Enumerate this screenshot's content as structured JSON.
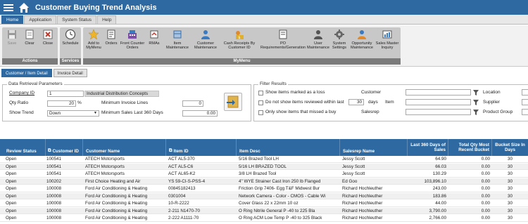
{
  "app": {
    "title": "Customer Buying Trend Analysis"
  },
  "tabs": [
    {
      "label": "Home",
      "active": true
    },
    {
      "label": "Application",
      "active": false
    },
    {
      "label": "System Status",
      "active": false
    },
    {
      "label": "Help",
      "active": false
    }
  ],
  "ribbon": {
    "actions": {
      "label": "Actions",
      "buttons": [
        "Save",
        "Clear",
        "Close"
      ]
    },
    "services": {
      "label": "Services",
      "buttons": [
        "Schedule"
      ]
    },
    "mymenu": {
      "label": "MyMenu",
      "buttons": [
        "Add to\nMyMenu",
        "Orders",
        "Front Counter\nOrders",
        "RMAs",
        "Item\nMaintenance",
        "Customer\nMaintenance",
        "Cash Receipts By\nCustomer ID",
        "PO\nRequirements/Generation",
        "User\nMaintenance",
        "System\nSettings",
        "Opportunity\nMaintenance",
        "Sales Master\nInquiry"
      ]
    }
  },
  "subtabs": [
    {
      "label": "Customer / Item Detail",
      "active": true
    },
    {
      "label": "Invoice Detail",
      "active": false
    }
  ],
  "params": {
    "legend": "Data Retrieval Parameters",
    "company_id_label": "Company ID",
    "company_id": "1",
    "company_name": "Industrial Distribution Concepts",
    "qty_ratio_label": "Qty Ratio",
    "qty_ratio": "20",
    "qty_ratio_unit": "%",
    "min_invoice_lines_label": "Minimum Invoice Lines",
    "min_invoice_lines": "0",
    "show_trend_label": "Show Trend",
    "show_trend": "Down",
    "min_sales_label": "Minimum Sales Last 360 Days",
    "min_sales": "0.00"
  },
  "filters": {
    "legend": "Filter Results",
    "loss_label": "Show items marked as a loss",
    "not_reviewed_label": "Do not show items reviewed within last",
    "not_reviewed_days": "30",
    "days_label": "days",
    "missed_buy_label": "Only show items that missed a buy",
    "customer_label": "Customer",
    "item_label": "Item",
    "salesrep_label": "Salesrep",
    "location_label": "Location",
    "supplier_label": "Supplier",
    "product_group_label": "Product Group"
  },
  "grid": {
    "columns": [
      "Review Status",
      "Customer ID",
      "Customer Name",
      "Item ID",
      "Item Desc",
      "Salesrep Name",
      "Last 360 Days of Sales",
      "Total Qty Most Recent Bucket",
      "Bucket Size In Days"
    ],
    "rows": [
      [
        "Open",
        "100541",
        "ATECH Motorsports",
        "ACT AL5-370",
        "5/16 Brazed Tool LH",
        "Jessy Scott",
        "64.90",
        "0.00",
        "30"
      ],
      [
        "Open",
        "100541",
        "ATECH Motorsports",
        "ACT AL5-C6",
        "5/16 LH BRAZED TOOL",
        "Jessy Scott",
        "66.03",
        "0.00",
        "30"
      ],
      [
        "Open",
        "100541",
        "ATECH Motorsports",
        "ACT AL65-K2",
        "3/8 LH Brazed Tool",
        "Jessy Scott",
        "130.29",
        "0.00",
        "30"
      ],
      [
        "Open",
        "100202",
        "First Choice Heating and Air",
        "YS 59-CI-S-PSS-4",
        "4\" WYE Strainer Cast Iron 250 lb Flanged",
        "Ed Goo",
        "103,896.10",
        "0.00",
        "30"
      ],
      [
        "Open",
        "100008",
        "Ford Air Conditioning & Heating",
        "00845182413",
        "Friction Grip 7406- Egg T&F Midwest Bur",
        "Richard Hochleuther",
        "243.00",
        "0.00",
        "30"
      ],
      [
        "Open",
        "100008",
        "Ford Air Conditioning & Heating",
        "0301004",
        "Network Camera - Color - CMOS - Cable Wi",
        "Richard Hochleuther",
        "183.86",
        "0.00",
        "30"
      ],
      [
        "Open",
        "100008",
        "Ford Air Conditioning & Heating",
        "10-R-2222",
        "Cover Glass 22 x 22mm 10 oz",
        "Richard Hochleuther",
        "44.00",
        "0.00",
        "30"
      ],
      [
        "Open",
        "100008",
        "Ford Air Conditioning & Heating",
        "2-211 N1470-70",
        "O Ring Nitrile General P -40 to 225 Bla",
        "Richard Hochleuther",
        "3,790.00",
        "0.00",
        "30"
      ],
      [
        "Open",
        "100008",
        "Ford Air Conditioning & Heating",
        "2-222 A1111-70",
        "O Ring ACM Low Temp P -40 to 325 Black",
        "Richard Hochleuther",
        "2,766.00",
        "0.00",
        "30"
      ]
    ]
  }
}
